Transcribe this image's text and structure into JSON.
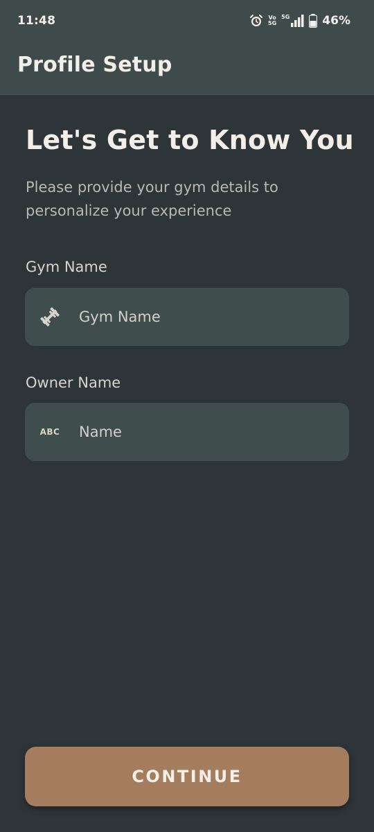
{
  "status_bar": {
    "time": "11:48",
    "network_top": "Vo",
    "network_bottom": "5G",
    "signal_label": "5G",
    "battery": "46%"
  },
  "appbar": {
    "title": "Profile Setup"
  },
  "main": {
    "heading": "Let's Get to Know You",
    "subtitle": "Please provide your gym details to personalize your experience"
  },
  "form": {
    "gym_name": {
      "label": "Gym Name",
      "placeholder": "Gym Name",
      "value": "",
      "icon": "dumbbell-icon"
    },
    "owner_name": {
      "label": "Owner Name",
      "placeholder": "Name",
      "value": "",
      "icon": "abc-icon",
      "icon_text": "ABC"
    }
  },
  "actions": {
    "continue_label": "CONTINUE"
  },
  "colors": {
    "background": "#2e3538",
    "appbar": "#3f4b4b",
    "field": "#3f4d4d",
    "accent": "#a47c5e"
  }
}
